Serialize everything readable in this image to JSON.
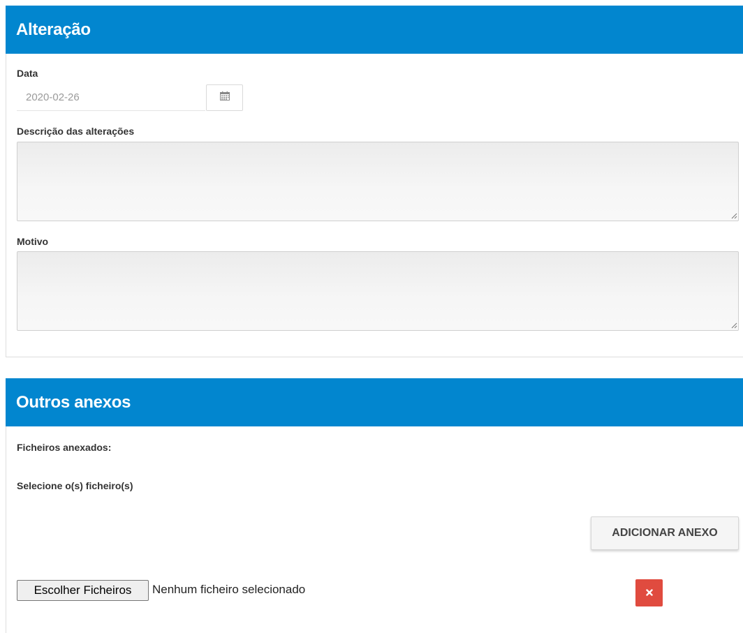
{
  "alteracao": {
    "title": "Alteração",
    "date_label": "Data",
    "date_value": "2020-02-26",
    "date_button_icon": "calendar-icon",
    "description_label": "Descrição das alterações",
    "description_value": "",
    "reason_label": "Motivo",
    "reason_value": ""
  },
  "anexos": {
    "title": "Outros anexos",
    "attached_label": "Ficheiros anexados:",
    "select_label": "Selecione o(s) ficheiro(s)",
    "add_button_label": "ADICIONAR ANEXO",
    "choose_button_label": "Escolher Ficheiros",
    "file_status": "Nenhum ficheiro selecionado",
    "remove_button_icon": "close-icon"
  },
  "colors": {
    "header_bg": "#0286cf",
    "remove_bg": "#e04b3f"
  }
}
